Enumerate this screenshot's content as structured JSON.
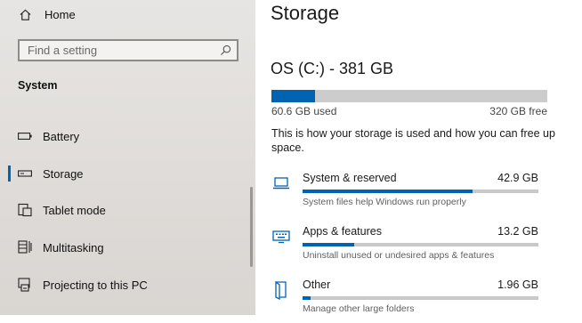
{
  "sidebar": {
    "home_label": "Home",
    "search_placeholder": "Find a setting",
    "section_title": "System",
    "items": [
      {
        "label": "Battery",
        "icon": "battery-icon"
      },
      {
        "label": "Storage",
        "icon": "drive-icon",
        "selected": true
      },
      {
        "label": "Tablet mode",
        "icon": "tablet-mode-icon"
      },
      {
        "label": "Multitasking",
        "icon": "multitasking-icon"
      },
      {
        "label": "Projecting to this PC",
        "icon": "projecting-icon"
      }
    ]
  },
  "main": {
    "page_title": "Storage",
    "drive": {
      "title": "OS (C:) - 381 GB",
      "used_label": "60.6 GB used",
      "free_label": "320 GB free",
      "used_fraction": 0.159
    },
    "description": "This is how your storage is used and how you can free up space.",
    "categories": [
      {
        "name": "System & reserved",
        "size": "42.9 GB",
        "hint": "System files help Windows run properly",
        "fill_fraction": 0.72,
        "icon": "laptop-icon"
      },
      {
        "name": "Apps & features",
        "size": "13.2 GB",
        "hint": "Uninstall unused or undesired apps & features",
        "fill_fraction": 0.22,
        "icon": "apps-keyboard-icon"
      },
      {
        "name": "Other",
        "size": "1.96 GB",
        "hint": "Manage other large folders",
        "fill_fraction": 0.035,
        "icon": "folder-icon"
      }
    ]
  },
  "colors": {
    "accent": "#0063b1",
    "sidebar_bg": "#e2dfdc",
    "bar_track": "#cccccc"
  }
}
